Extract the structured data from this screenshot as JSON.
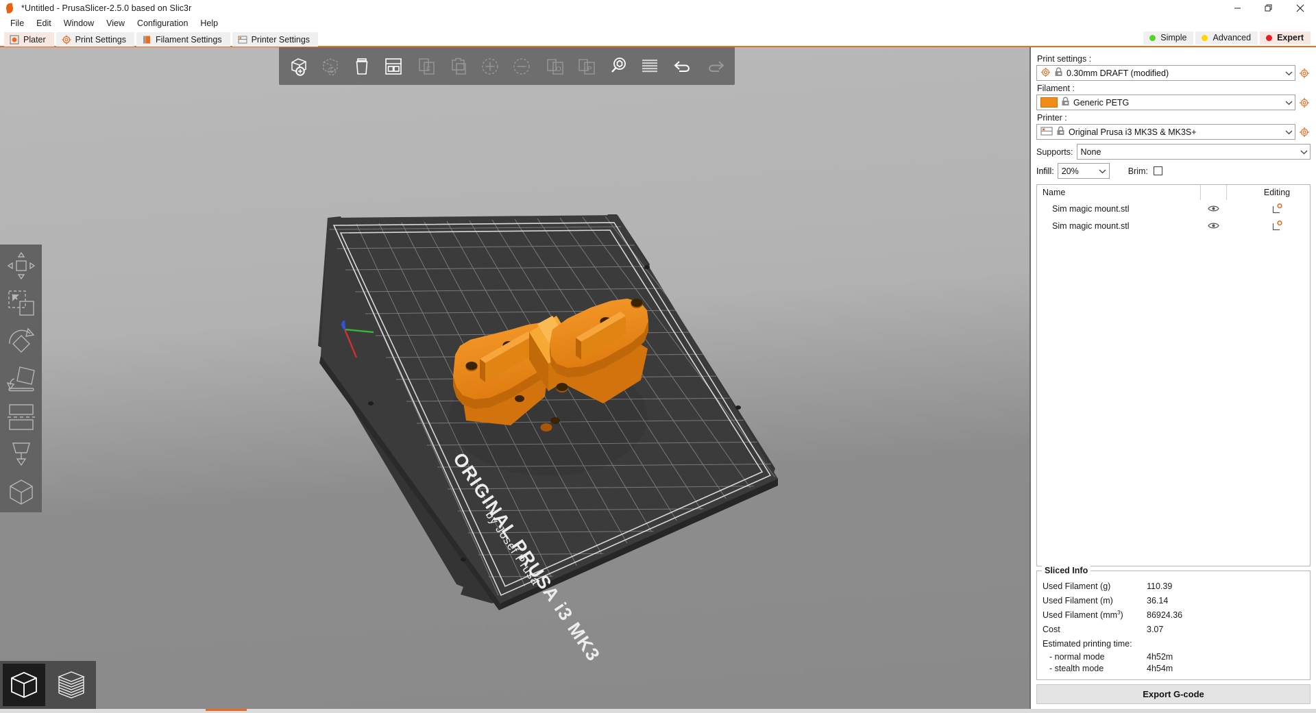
{
  "window": {
    "title": "*Untitled - PrusaSlicer-2.5.0 based on Slic3r",
    "logo_icon": "prusa-leaf-logo",
    "buttons": [
      {
        "name": "minimize-button",
        "icon": "minimize-icon"
      },
      {
        "name": "restore-button",
        "icon": "restore-icon"
      },
      {
        "name": "close-button",
        "icon": "close-icon"
      }
    ]
  },
  "menubar": {
    "items": [
      {
        "label": "File"
      },
      {
        "label": "Edit"
      },
      {
        "label": "Window"
      },
      {
        "label": "View"
      },
      {
        "label": "Configuration"
      },
      {
        "label": "Help"
      }
    ]
  },
  "tabs": [
    {
      "label": "Plater",
      "icon": "plater-icon",
      "active": true
    },
    {
      "label": "Print Settings",
      "icon": "print-settings-cog-icon",
      "active": false
    },
    {
      "label": "Filament Settings",
      "icon": "filament-spool-icon",
      "active": false
    },
    {
      "label": "Printer Settings",
      "icon": "printer-icon",
      "active": false
    }
  ],
  "modes": [
    {
      "label": "Simple",
      "color": "#57d12c",
      "active": false
    },
    {
      "label": "Advanced",
      "color": "#ffd500",
      "active": false
    },
    {
      "label": "Expert",
      "color": "#ed1c24",
      "active": true
    }
  ],
  "toolbar": {
    "items": [
      {
        "name": "add-object-button",
        "icon": "add-cube-icon",
        "enabled": true
      },
      {
        "name": "delete-object-button",
        "icon": "remove-cube-icon",
        "enabled": false
      },
      {
        "name": "delete-all-button",
        "icon": "trash-icon",
        "enabled": true
      },
      {
        "name": "arrange-button",
        "icon": "arrange-grid-icon",
        "enabled": true
      },
      {
        "name": "copy-button",
        "icon": "copy-icon",
        "enabled": false
      },
      {
        "name": "paste-button",
        "icon": "paste-icon",
        "enabled": false
      },
      {
        "name": "add-instance-button",
        "icon": "plus-circle-icon",
        "enabled": false
      },
      {
        "name": "remove-instance-button",
        "icon": "minus-circle-icon",
        "enabled": false
      },
      {
        "name": "split-to-objects-button",
        "icon": "split-objects-icon",
        "enabled": false
      },
      {
        "name": "split-to-parts-button",
        "icon": "split-parts-icon",
        "enabled": false
      },
      {
        "name": "search-button",
        "icon": "search-icon",
        "enabled": true
      },
      {
        "name": "layers-editing-button",
        "icon": "variable-layer-height-icon",
        "enabled": true
      },
      {
        "name": "undo-button",
        "icon": "undo-arrow-icon",
        "enabled": true
      },
      {
        "name": "redo-button",
        "icon": "redo-arrow-icon",
        "enabled": false
      }
    ]
  },
  "gizmos": {
    "items": [
      {
        "name": "gizmo-move",
        "icon": "move-arrows-icon"
      },
      {
        "name": "gizmo-scale",
        "icon": "scale-icon"
      },
      {
        "name": "gizmo-rotate",
        "icon": "rotate-icon"
      },
      {
        "name": "gizmo-place-on-face",
        "icon": "place-on-face-icon"
      },
      {
        "name": "gizmo-cut",
        "icon": "cut-icon"
      },
      {
        "name": "gizmo-support-painting",
        "icon": "support-enforcer-icon"
      },
      {
        "name": "gizmo-seam-painting",
        "icon": "seam-cube-icon"
      }
    ]
  },
  "view_switch": {
    "items": [
      {
        "name": "view-3d-editor",
        "icon": "cube-icon",
        "active": true
      },
      {
        "name": "view-preview",
        "icon": "layer-stack-icon",
        "active": false
      }
    ]
  },
  "plater": {
    "bed_brand_text": "ORIGINAL PRUSA i3 MK3",
    "bed_author_text": "by Josef Prusa",
    "model_color": "#e8861a",
    "bed_color": "#3c3c3c",
    "axis_colors": {
      "x": "#d32f2f",
      "y": "#36b536",
      "z": "#2f57d3"
    }
  },
  "sidebar": {
    "print_settings": {
      "label": "Print settings :",
      "value": "0.30mm DRAFT (modified)",
      "icon": "print-settings-cog-icon",
      "lock_icon": "lock-closed-icon",
      "edit_icon": "cog-icon"
    },
    "filament": {
      "label": "Filament :",
      "value": "Generic PETG",
      "swatch_color": "#f28c18",
      "lock_icon": "lock-closed-icon",
      "edit_icon": "cog-icon"
    },
    "printer": {
      "label": "Printer :",
      "value": "Original Prusa i3 MK3S & MK3S+",
      "icon": "printer-icon",
      "lock_icon": "lock-closed-icon",
      "edit_icon": "cog-icon"
    },
    "supports": {
      "label": "Supports:",
      "value": "None"
    },
    "infill": {
      "label": "Infill:",
      "value": "20%"
    },
    "brim": {
      "label": "Brim:",
      "checked": false
    },
    "object_list": {
      "columns": {
        "name": "Name",
        "editing": "Editing"
      },
      "rows": [
        {
          "name": "Sim magic mount.stl",
          "eye_icon": "eye-icon",
          "editing_icon": "settings-modifier-icon"
        },
        {
          "name": "Sim magic mount.stl",
          "eye_icon": "eye-icon",
          "editing_icon": "settings-modifier-icon"
        }
      ]
    },
    "sliced_info": {
      "legend": "Sliced Info",
      "rows": [
        {
          "key": "Used Filament (g)",
          "value": "110.39"
        },
        {
          "key": "Used Filament (m)",
          "value": "36.14"
        },
        {
          "key": "Used Filament (mm³)",
          "value": "86924.36",
          "key_html": "Used Filament (mm<sup>3</sup>)"
        },
        {
          "key": "Cost",
          "value": "3.07"
        }
      ],
      "time_header": "Estimated printing time:",
      "time_rows": [
        {
          "key": "- normal mode",
          "value": "4h52m"
        },
        {
          "key": "- stealth mode",
          "value": "4h54m"
        }
      ]
    },
    "export_button": "Export G-code"
  }
}
